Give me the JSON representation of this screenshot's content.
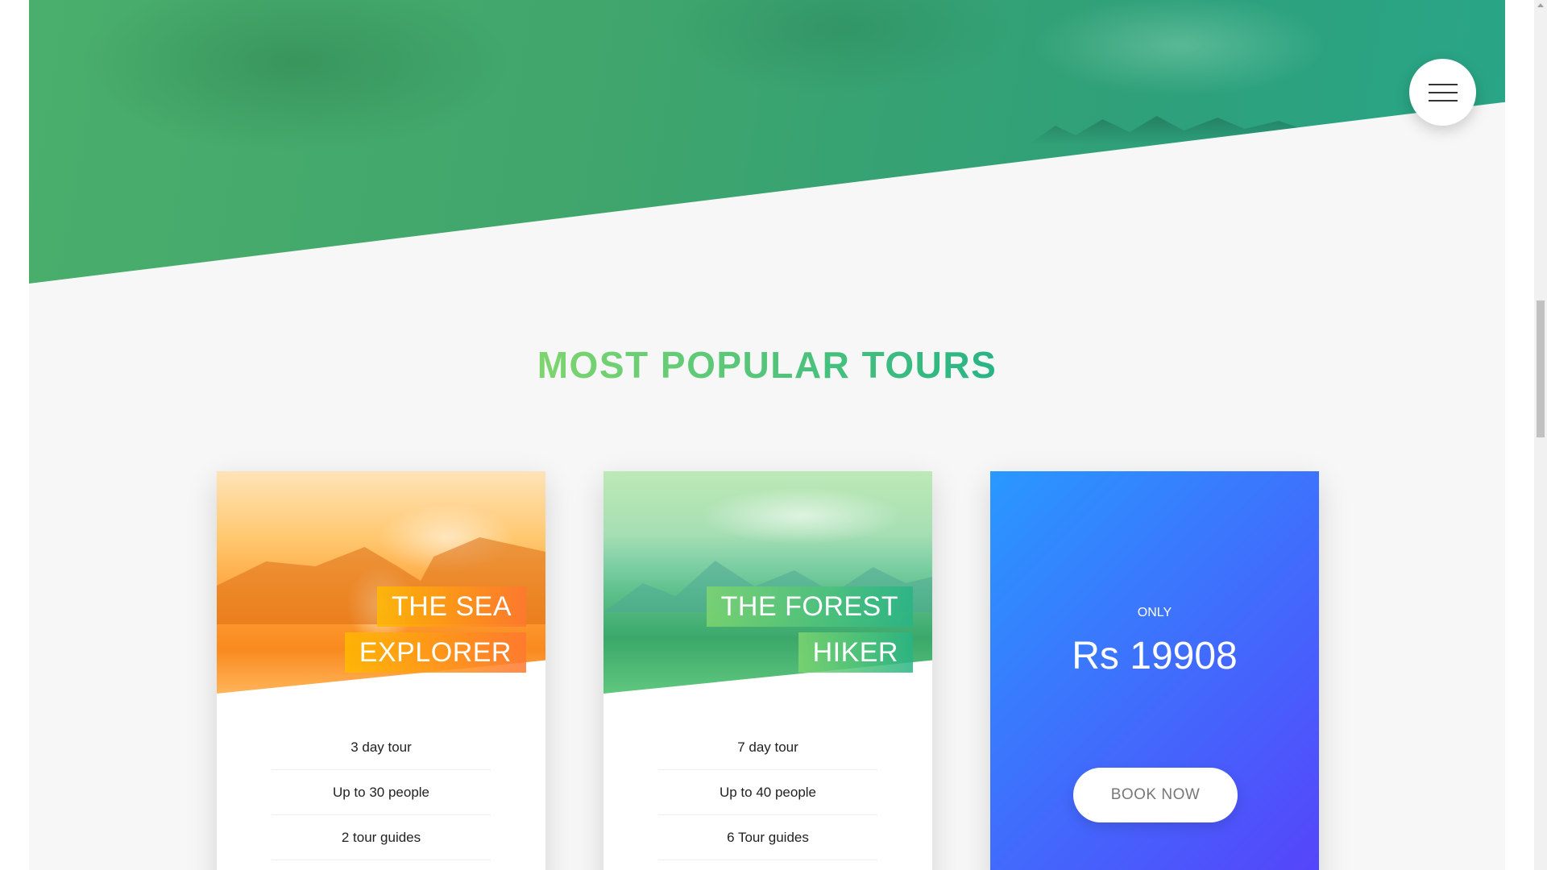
{
  "hero": {
    "menu_icon": "hamburger-menu-icon"
  },
  "section": {
    "title": "MOST POPULAR TOURS"
  },
  "tours": [
    {
      "heading_line1": "THE SEA",
      "heading_line2": "EXPLORER",
      "details": [
        "3 day tour",
        "Up to 30 people",
        "2 tour guides"
      ],
      "theme_color": "#ff9f2d"
    },
    {
      "heading_line1": "THE FOREST",
      "heading_line2": "HIKER",
      "details": [
        "7 day tour",
        "Up to 40 people",
        "6 Tour guides"
      ],
      "theme_color": "#55c57a"
    }
  ],
  "price_card": {
    "only_label": "ONLY",
    "price": "Rs 19908",
    "button_label": "BOOK NOW",
    "gradient_start": "#2998ff",
    "gradient_end": "#5643fa"
  },
  "colors": {
    "brand_green_light": "#7ed56f",
    "brand_green_dark": "#28b485",
    "page_background": "#f7f7f7"
  }
}
